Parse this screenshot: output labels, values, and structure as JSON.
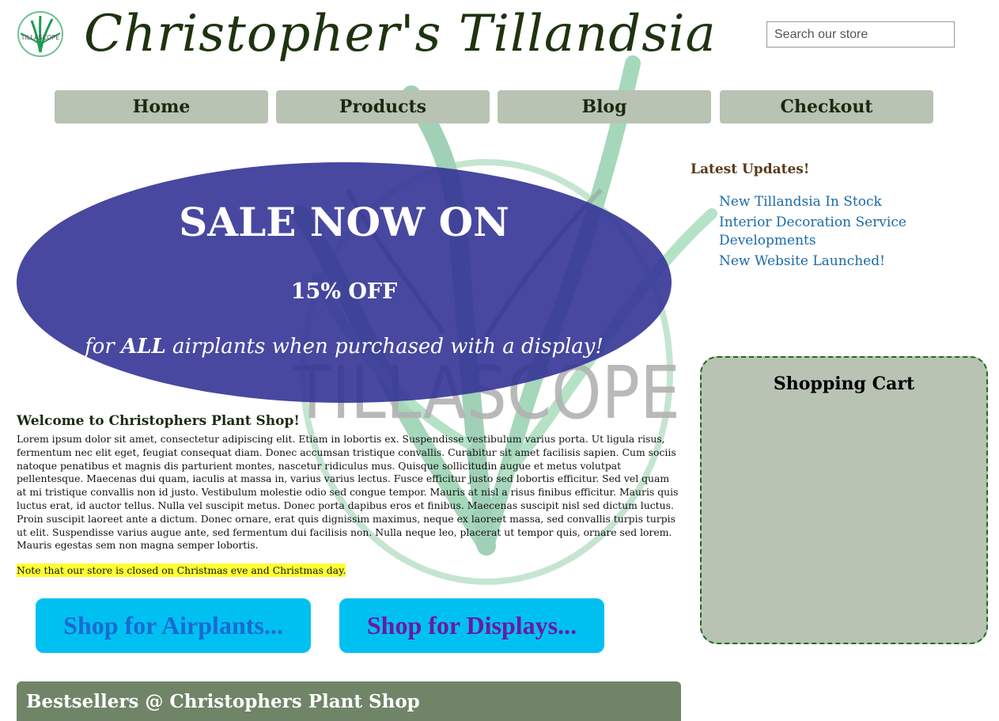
{
  "header": {
    "site_title": "Christopher's Tillandsia",
    "logo_text": "TILLASCOPE"
  },
  "search": {
    "placeholder": "Search our store",
    "value": ""
  },
  "nav": {
    "items": [
      {
        "label": "Home"
      },
      {
        "label": "Products"
      },
      {
        "label": "Blog"
      },
      {
        "label": "Checkout"
      }
    ]
  },
  "sale": {
    "title": "SALE NOW ON",
    "discount": "15% OFF",
    "note_prefix": "for ",
    "note_emphasis": "ALL",
    "note_suffix": " airplants when purchased with a display!"
  },
  "updates": {
    "heading": "Latest Updates!",
    "items": [
      {
        "label": "New Tillandsia In Stock"
      },
      {
        "label": "Interior Decoration Service Developments"
      },
      {
        "label": "New Website Launched!"
      }
    ]
  },
  "cart": {
    "title": "Shopping Cart"
  },
  "welcome": {
    "heading": "Welcome to Christophers Plant Shop!",
    "body": "Lorem ipsum dolor sit amet, consectetur adipiscing elit. Etiam in lobortis ex. Suspendisse vestibulum varius porta. Ut ligula risus, fermentum nec elit eget, feugiat consequat diam. Donec accumsan tristique convallis. Curabitur sit amet facilisis sapien. Cum sociis natoque penatibus et magnis dis parturient montes, nascetur ridiculus mus. Quisque sollicitudin augue et metus volutpat pellentesque. Maecenas dui quam, iaculis at massa in, varius varius lectus. Fusce efficitur justo sed lobortis efficitur. Sed vel quam at mi tristique convallis non id justo. Vestibulum molestie odio sed congue tempor. Mauris at nisl a risus finibus efficitur. Mauris quis luctus erat, id auctor tellus. Nulla vel suscipit metus. Donec porta dapibus eros et finibus. Maecenas suscipit nisl sed dictum luctus. Proin suscipit laoreet ante a dictum. Donec ornare, erat quis dignissim maximus, neque ex laoreet massa, sed convallis turpis turpis ut elit. Suspendisse varius augue ante, sed fermentum dui facilisis non. Nulla neque leo, placerat ut tempor quis, ornare sed lorem. Mauris egestas sem non magna semper lobortis.",
    "notice": "Note that our store is closed on Christmas eve and Christmas day."
  },
  "shop_buttons": {
    "airplants": "Shop for Airplants...",
    "displays": "Shop for Displays..."
  },
  "bestsellers": {
    "heading": "Bestsellers @ Christophers Plant Shop"
  },
  "colors": {
    "nav_bg": "#b8c3b3",
    "sale_bg": "#343496",
    "link": "#1a6aa8",
    "shop_button_bg": "#00c0f2",
    "bestsellers_bg": "#708467",
    "notice_highlight": "#ffff33"
  },
  "watermark": {
    "text": "TILLASCOPE"
  }
}
